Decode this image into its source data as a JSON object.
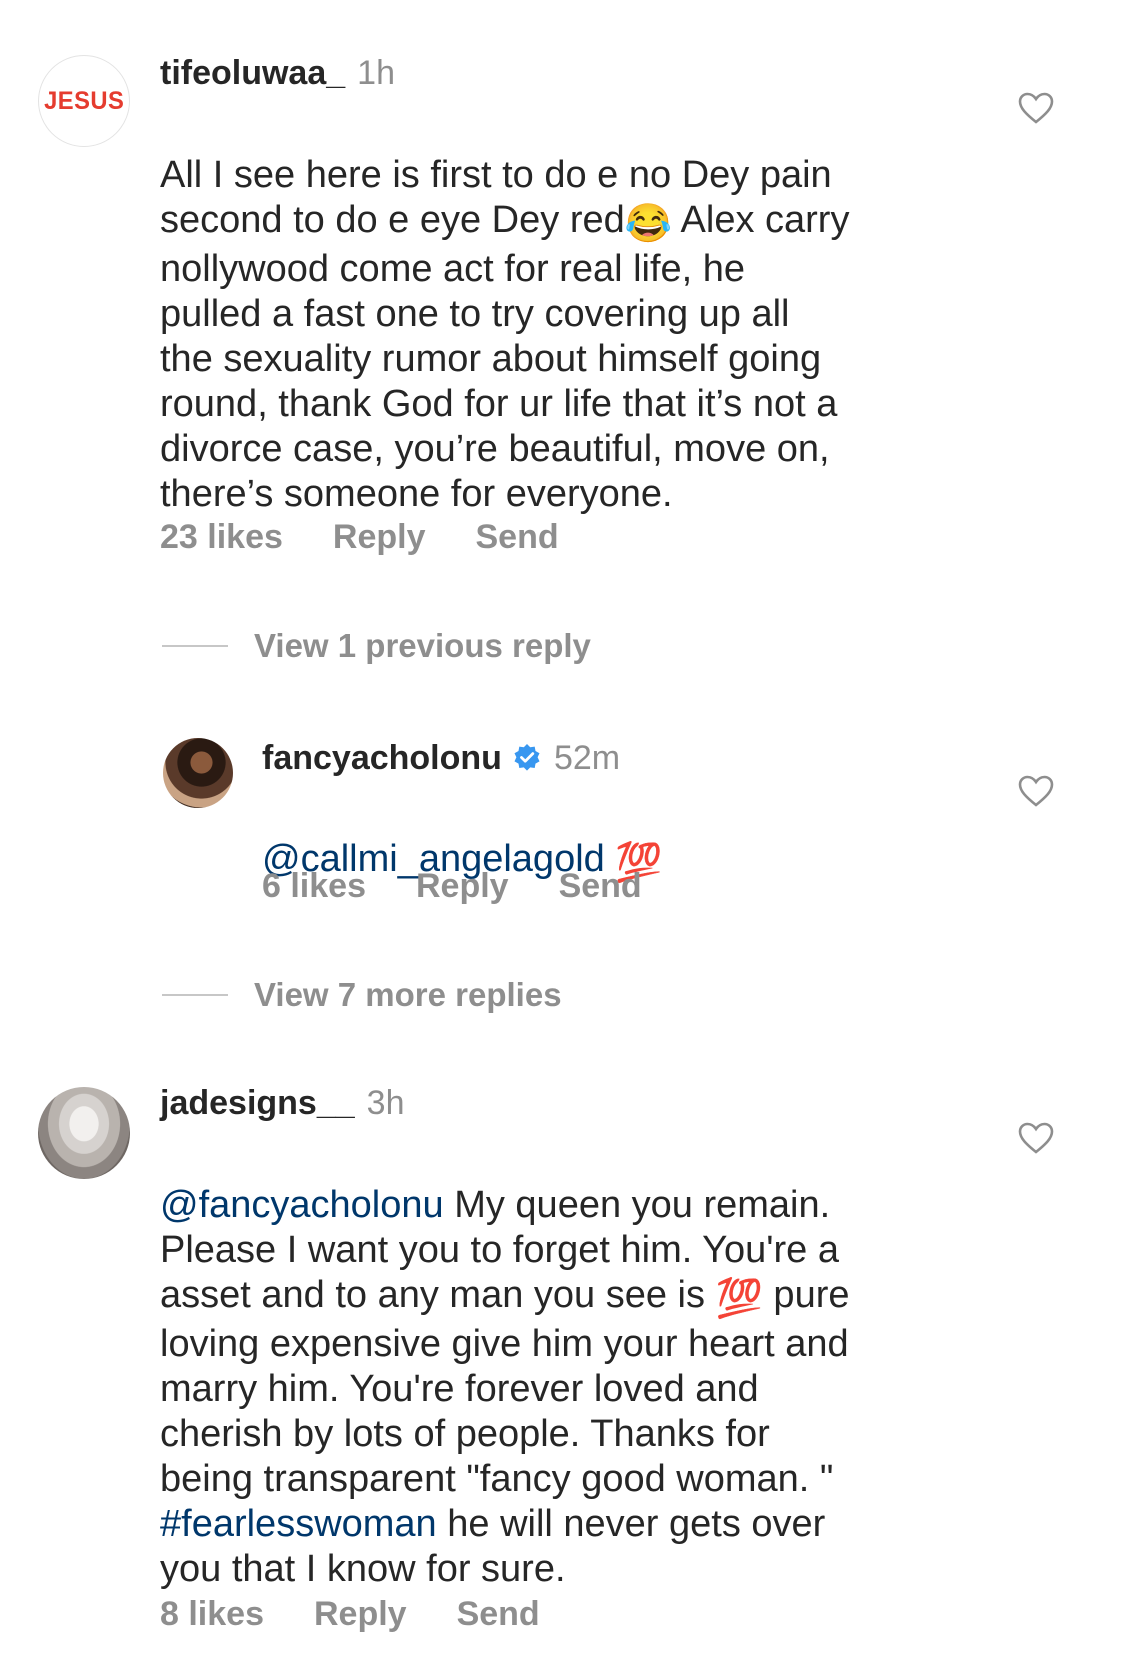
{
  "comments": [
    {
      "avatar_text": "JESUS",
      "username": "tifeoluwaa_",
      "time": "1h",
      "text_parts": [
        "All I see here is first to do e no Dey pain\nsecond to do e eye Dey red",
        " Alex carry\nnollywood come act for real life, he\npulled a fast one to try covering up all\nthe sexuality rumor about himself going\nround, thank God for ur life that it’s not a\ndivorce case, you’re beautiful, move on,\nthere’s someone for everyone."
      ],
      "emoji": "😂",
      "likes": "23 likes",
      "reply": "Reply",
      "send": "Send"
    }
  ],
  "view_previous": "View 1 previous reply",
  "reply": {
    "username": "fancyacholonu",
    "time": "52m",
    "mention": "@callmi_angelagold",
    "emoji": "💯",
    "likes": "6 likes",
    "reply": "Reply",
    "send": "Send"
  },
  "view_more": "View 7 more replies",
  "comment2": {
    "username": "jadesigns__",
    "time": "3h",
    "mention": "@fancyacholonu",
    "text1": " My queen you remain.\nPlease I want you to forget him. You're a\nasset and to any man you see is ",
    "emoji": "💯",
    "text2": " pure\nloving expensive give him your heart and\nmarry him. You're forever loved and\ncherish by lots of people. Thanks for\nbeing transparent \"fancy good woman. \"\n",
    "hashtag": "#fearlesswoman",
    "text3": "  he will never gets over\nyou that I know for sure.",
    "likes": "8 likes",
    "reply": "Reply",
    "send": "Send"
  },
  "icons": {
    "heart": "heart-outline-icon",
    "verified": "verified-badge-icon"
  },
  "colors": {
    "text": "#262626",
    "secondary": "#8e8e8e",
    "link": "#00376b",
    "verified": "#3897f0",
    "jesus_red": "#e53c2f"
  }
}
